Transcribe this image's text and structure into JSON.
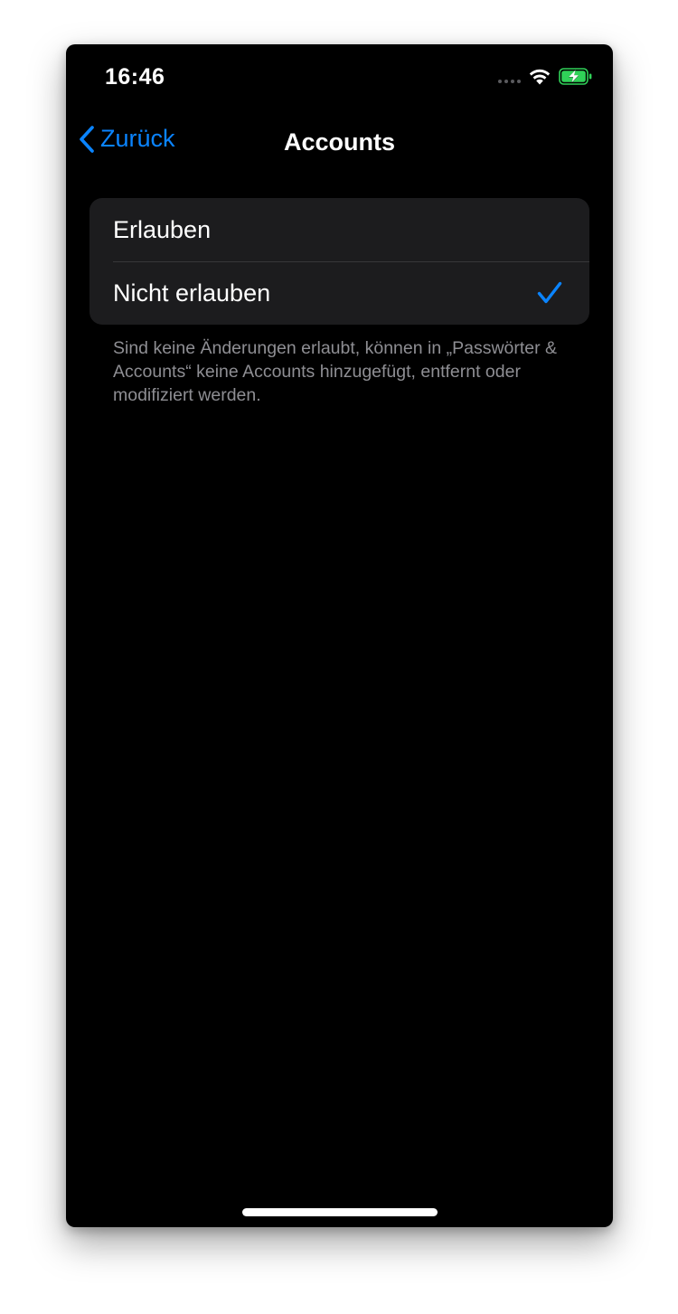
{
  "status_bar": {
    "time": "16:46",
    "battery_color": "#30d158"
  },
  "nav": {
    "back_label": "Zurück",
    "title": "Accounts"
  },
  "options": [
    {
      "label": "Erlauben",
      "selected": false
    },
    {
      "label": "Nicht erlauben",
      "selected": true
    }
  ],
  "footer_note": "Sind keine Änderungen erlaubt, können in „Pass­wörter & Accounts“ keine Accounts hinzugefügt, entfernt oder modifiziert werden.",
  "colors": {
    "accent": "#0a84ff",
    "background": "#000000",
    "group_background": "#1c1c1e",
    "secondary_text": "#8e8e93"
  },
  "icons": {
    "back": "chevron-left-icon",
    "selected": "checkmark-icon",
    "wifi": "wifi-icon",
    "battery": "battery-charging-icon"
  }
}
